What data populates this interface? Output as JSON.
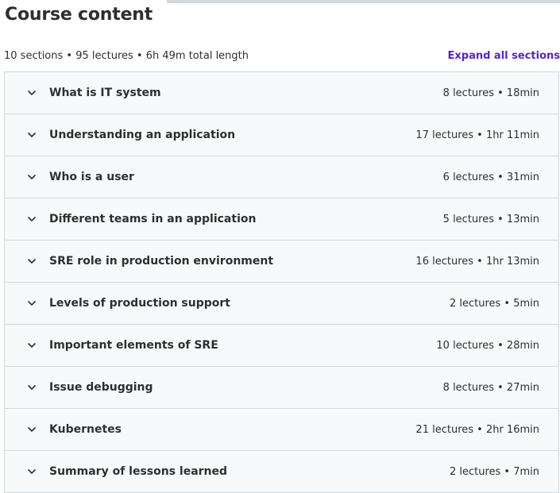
{
  "header": {
    "title": "Course content",
    "summary": "10 sections • 95 lectures • 6h 49m total length",
    "expand_all_label": "Expand all sections"
  },
  "sections": [
    {
      "title": "What is IT system",
      "meta": "8 lectures • 18min"
    },
    {
      "title": "Understanding an application",
      "meta": "17 lectures • 1hr 11min"
    },
    {
      "title": "Who is a user",
      "meta": "6 lectures • 31min"
    },
    {
      "title": "Different teams in an application",
      "meta": "5 lectures • 13min"
    },
    {
      "title": "SRE role in production environment",
      "meta": "16 lectures • 1hr 13min"
    },
    {
      "title": "Levels of production support",
      "meta": "2 lectures • 5min"
    },
    {
      "title": "Important elements of SRE",
      "meta": "10 lectures • 28min"
    },
    {
      "title": "Issue debugging",
      "meta": "8 lectures • 27min"
    },
    {
      "title": "Kubernetes",
      "meta": "21 lectures • 2hr 16min"
    },
    {
      "title": "Summary of lessons learned",
      "meta": "2 lectures • 7min"
    }
  ],
  "colors": {
    "accent": "#5624d0",
    "row_background": "#f7f9fa",
    "border": "#d1d7dc",
    "text": "#2d2f31"
  },
  "icons": {
    "section_toggle": "chevron-down-icon"
  }
}
